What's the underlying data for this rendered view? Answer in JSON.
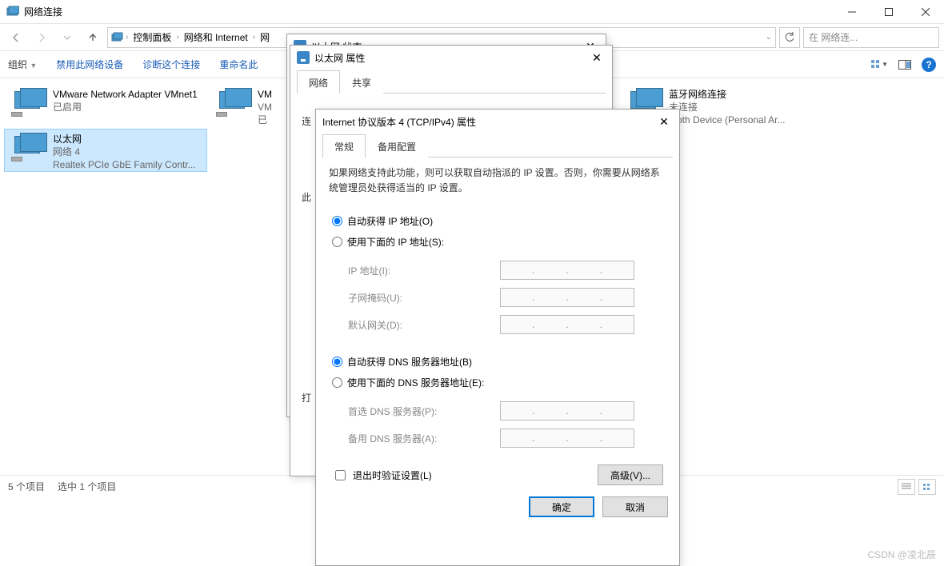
{
  "window": {
    "title": "网络连接",
    "breadcrumbs": [
      "控制面板",
      "网络和 Internet",
      "网"
    ],
    "search_placeholder": "在 网络连...",
    "commands": {
      "organize": "组织",
      "disable": "禁用此网络设备",
      "diagnose": "诊断这个连接",
      "rename": "重命名此"
    }
  },
  "connections": [
    {
      "name": "VMware Network Adapter VMnet1",
      "status": "已启用",
      "device": ""
    },
    {
      "name": "VM",
      "status": "VM",
      "device": "已"
    },
    {
      "name": "蓝牙网络连接",
      "status": "未连接",
      "device": "tooth Device (Personal Ar..."
    },
    {
      "name": "以太网",
      "status": "网络 4",
      "device": "Realtek PCIe GbE Family Contr..."
    }
  ],
  "statusbar": {
    "count": "5 个项目",
    "selected": "选中 1 个项目"
  },
  "dlg_status": {
    "title": "以太网 状态"
  },
  "dlg_props": {
    "title": "以太网 属性",
    "tabs": [
      "网络",
      "共享"
    ],
    "line1": "连",
    "line2": "此",
    "line3": "打"
  },
  "dlg_ipv4": {
    "title": "Internet 协议版本 4 (TCP/IPv4) 属性",
    "tabs": [
      "常规",
      "备用配置"
    ],
    "desc": "如果网络支持此功能，则可以获取自动指派的 IP 设置。否则，你需要从网络系统管理员处获得适当的 IP 设置。",
    "radio_auto_ip": "自动获得 IP 地址(O)",
    "radio_manual_ip": "使用下面的 IP 地址(S):",
    "label_ip": "IP 地址(I):",
    "label_mask": "子网掩码(U):",
    "label_gw": "默认网关(D):",
    "radio_auto_dns": "自动获得 DNS 服务器地址(B)",
    "radio_manual_dns": "使用下面的 DNS 服务器地址(E):",
    "label_dns1": "首选 DNS 服务器(P):",
    "label_dns2": "备用 DNS 服务器(A):",
    "chk_validate": "退出时验证设置(L)",
    "btn_advanced": "高级(V)...",
    "btn_ok": "确定",
    "btn_cancel": "取消"
  },
  "watermark": "CSDN @凌北辰"
}
